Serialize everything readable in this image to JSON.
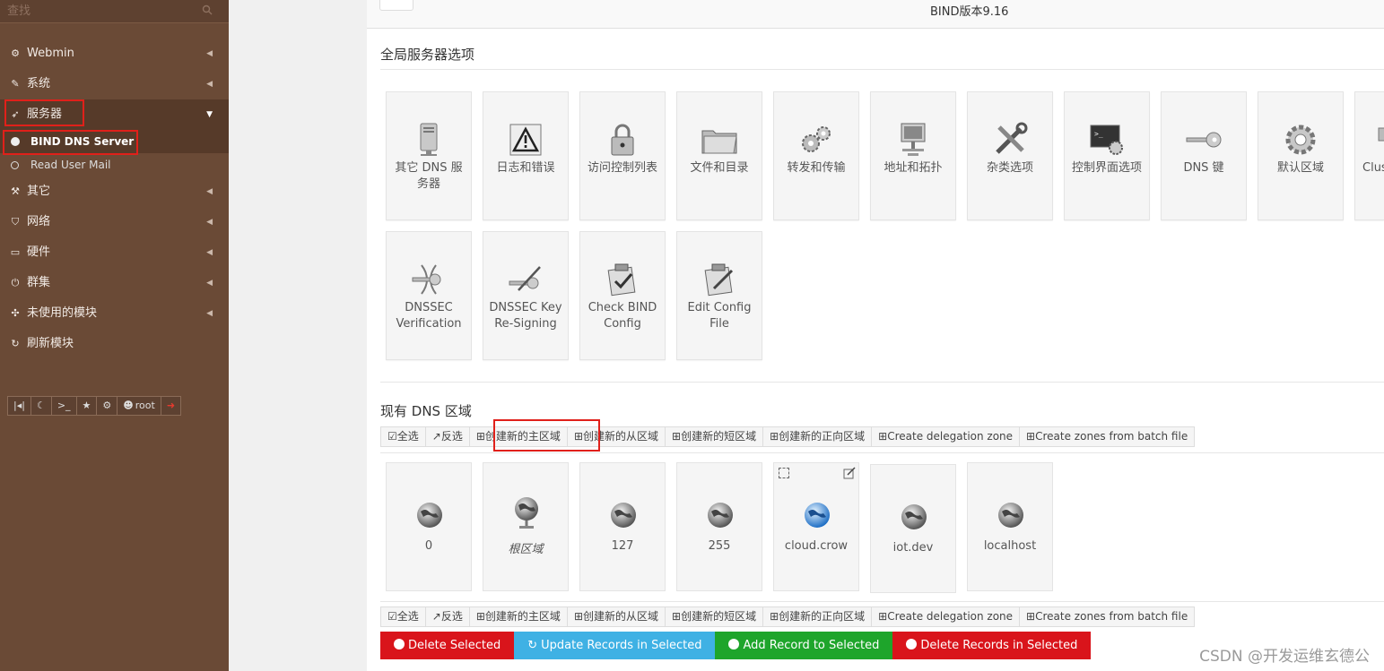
{
  "search": {
    "placeholder": "查找"
  },
  "sidebar": {
    "items": [
      {
        "label": "Webmin",
        "icon": "gear-icon"
      },
      {
        "label": "系统",
        "icon": "wrench-icon"
      },
      {
        "label": "服务器",
        "icon": "rocket-icon"
      },
      {
        "label": "其它",
        "icon": "gavel-icon"
      },
      {
        "label": "网络",
        "icon": "shield-icon"
      },
      {
        "label": "硬件",
        "icon": "hdd-icon"
      },
      {
        "label": "群集",
        "icon": "power-icon"
      },
      {
        "label": "未使用的模块",
        "icon": "puzzle-icon"
      },
      {
        "label": "刷新模块",
        "icon": "refresh-icon"
      }
    ],
    "subitems": [
      {
        "label": "BIND DNS Server",
        "active": true
      },
      {
        "label": "Read User Mail",
        "active": false
      }
    ],
    "toolbar_user": "root"
  },
  "header": {
    "version": "BIND版本9.16"
  },
  "global": {
    "title": "全局服务器选项",
    "tiles": [
      {
        "label": "其它 DNS 服务器",
        "icon": "server-icon"
      },
      {
        "label": "日志和错误",
        "icon": "warning-icon"
      },
      {
        "label": "访问控制列表",
        "icon": "lock-icon"
      },
      {
        "label": "文件和目录",
        "icon": "folder-icon"
      },
      {
        "label": "转发和传输",
        "icon": "gears-icon"
      },
      {
        "label": "地址和拓扑",
        "icon": "network-icon"
      },
      {
        "label": "杂类选项",
        "icon": "tools-icon"
      },
      {
        "label": "控制界面选项",
        "icon": "terminal-icon"
      },
      {
        "label": "DNS 键",
        "icon": "key-icon"
      },
      {
        "label": "默认区域",
        "icon": "gear-icon"
      },
      {
        "label": "Clus S",
        "icon": "cluster-icon"
      },
      {
        "label": "DNSSEC Verification",
        "icon": "dnssec-icon"
      },
      {
        "label": "DNSSEC Key Re-Signing",
        "icon": "key-sign-icon"
      },
      {
        "label": "Check BIND Config",
        "icon": "check-config-icon"
      },
      {
        "label": "Edit Config File",
        "icon": "edit-config-icon"
      }
    ]
  },
  "zones": {
    "title": "现有 DNS 区域",
    "buttons": [
      "全选",
      "反选",
      "创建新的主区域",
      "创建新的从区域",
      "创建新的短区域",
      "创建新的正向区域",
      "Create delegation zone",
      "Create zones from batch file"
    ],
    "items": [
      {
        "label": "0",
        "color": "gray"
      },
      {
        "label": "根区域",
        "color": "gray"
      },
      {
        "label": "127",
        "color": "gray"
      },
      {
        "label": "255",
        "color": "gray"
      },
      {
        "label": "cloud.crow",
        "color": "blue"
      },
      {
        "label": "iot.dev",
        "color": "gray"
      },
      {
        "label": "localhost",
        "color": "gray"
      }
    ]
  },
  "actions": [
    {
      "label": "Delete Selected",
      "color": "#d9141b"
    },
    {
      "label": "Update Records in Selected",
      "color": "#3fb1e4"
    },
    {
      "label": "Add Record to Selected",
      "color": "#1ea52b"
    },
    {
      "label": "Delete Records in Selected",
      "color": "#d9141b"
    }
  ],
  "watermark": "CSDN @开发运维玄德公"
}
